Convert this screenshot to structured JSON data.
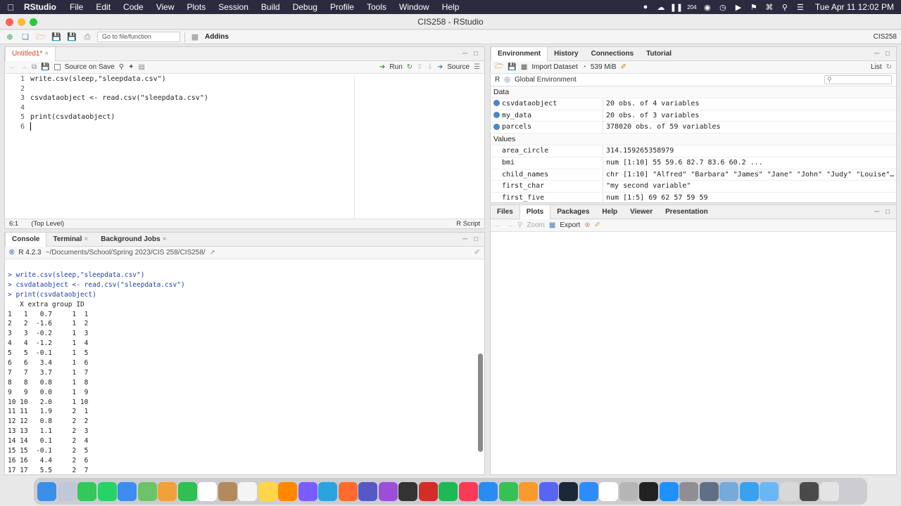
{
  "menubar": {
    "app_name": "RStudio",
    "items": [
      "File",
      "Edit",
      "Code",
      "View",
      "Plots",
      "Session",
      "Build",
      "Debug",
      "Profile",
      "Tools",
      "Window",
      "Help"
    ],
    "clock": "Tue Apr 11  12:02 PM",
    "tray_badges": [
      "204"
    ]
  },
  "window": {
    "title": "CIS258 - RStudio"
  },
  "toolbar": {
    "goto_placeholder": "Go to file/function",
    "addins_label": "Addins",
    "project_label": "CIS258"
  },
  "editor": {
    "tab_label": "Untitled1*",
    "source_on_save": "Source on Save",
    "run_label": "Run",
    "source_label": "Source",
    "lines": [
      "write.csv(sleep,\"sleepdata.csv\")",
      "",
      "csvdataobject <- read.csv(\"sleepdata.csv\")",
      "",
      "print(csvdataobject)",
      ""
    ],
    "status_position": "6:1",
    "status_scope": "(Top Level)",
    "status_type": "R Script"
  },
  "console": {
    "tabs": [
      "Console",
      "Terminal",
      "Background Jobs"
    ],
    "r_version": "R 4.2.3",
    "path": "~/Documents/School/Spring 2023/CIS 258/CIS258/",
    "commands": [
      "> write.csv(sleep,\"sleepdata.csv\")",
      "> csvdataobject <- read.csv(\"sleepdata.csv\")",
      "> print(csvdataobject)"
    ],
    "header": "   X extra group ID",
    "rows": [
      "1   1   0.7     1  1",
      "2   2  -1.6     1  2",
      "3   3  -0.2     1  3",
      "4   4  -1.2     1  4",
      "5   5  -0.1     1  5",
      "6   6   3.4     1  6",
      "7   7   3.7     1  7",
      "8   8   0.8     1  8",
      "9   9   0.0     1  9",
      "10 10   2.0     1 10",
      "11 11   1.9     2  1",
      "12 12   0.8     2  2",
      "13 13   1.1     2  3",
      "14 14   0.1     2  4",
      "15 15  -0.1     2  5",
      "16 16   4.4     2  6",
      "17 17   5.5     2  7"
    ]
  },
  "environment": {
    "tabs": [
      "Environment",
      "History",
      "Connections",
      "Tutorial"
    ],
    "import_label": "Import Dataset",
    "memory": "539 MiB",
    "view_mode": "List",
    "language": "R",
    "scope": "Global Environment",
    "data_section": "Data",
    "data": [
      {
        "name": "csvdataobject",
        "value": "20 obs. of 4 variables"
      },
      {
        "name": "my_data",
        "value": "20 obs. of 3 variables"
      },
      {
        "name": "parcels",
        "value": "378020 obs. of 59 variables"
      }
    ],
    "values_section": "Values",
    "values": [
      {
        "name": "area_circle",
        "value": "314.159265358979"
      },
      {
        "name": "bmi",
        "value": "num [1:10] 55 59.6 82.7 83.6 60.2 ..."
      },
      {
        "name": "child_names",
        "value": "chr [1:10] \"Alfred\" \"Barbara\" \"James\" \"Jane\" \"John\" \"Judy\" \"Louise\"…"
      },
      {
        "name": "first_char",
        "value": "\"my second variable\""
      },
      {
        "name": "first_five",
        "value": "num [1:5] 69 62 57 59 59"
      }
    ]
  },
  "files": {
    "tabs": [
      "Files",
      "Plots",
      "Packages",
      "Help",
      "Viewer",
      "Presentation"
    ],
    "zoom_label": "Zoom",
    "export_label": "Export"
  },
  "colors": {
    "menubar_bg": "#2b2b40",
    "accent": "#4a86c8",
    "console_cmd": "#1b3fa8"
  }
}
